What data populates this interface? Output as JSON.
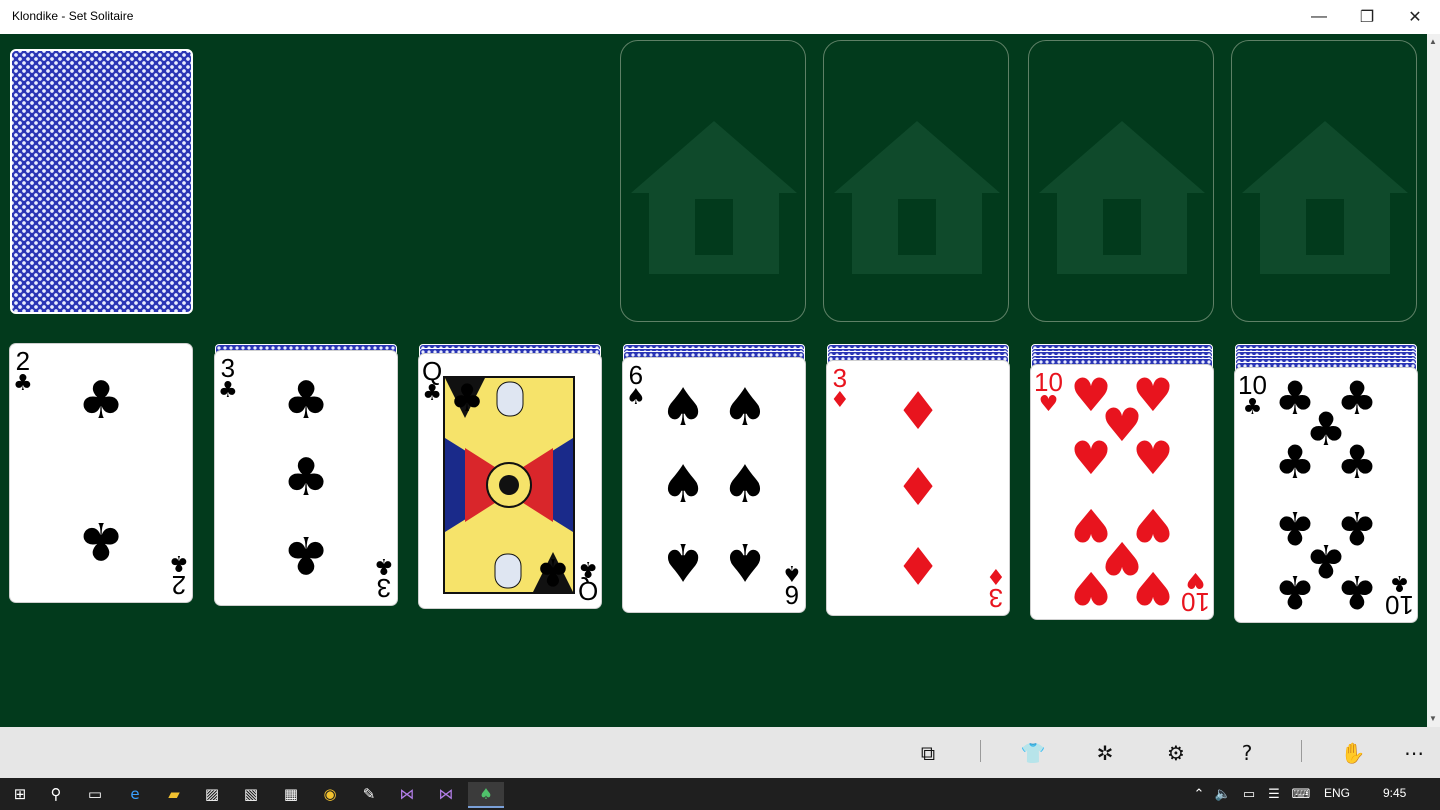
{
  "window": {
    "title": "Klondike - Set Solitaire",
    "controls": {
      "minimize": "—",
      "restore": "❐",
      "close": "✕"
    }
  },
  "colors": {
    "felt": "#023a1c",
    "red_suit": "#e8141e",
    "black_suit": "#000000",
    "card_back": "#2a35b5"
  },
  "stock": {
    "face": "down",
    "icon": "card-back-pattern"
  },
  "foundations": [
    {
      "icon": "house-icon"
    },
    {
      "icon": "house-icon"
    },
    {
      "icon": "house-icon"
    },
    {
      "icon": "house-icon"
    }
  ],
  "tableau": [
    {
      "hidden_cards": 0,
      "top": {
        "rank": "2",
        "suit": "♣",
        "color": "black"
      }
    },
    {
      "hidden_cards": 1,
      "top": {
        "rank": "3",
        "suit": "♣",
        "color": "black"
      }
    },
    {
      "hidden_cards": 2,
      "top": {
        "rank": "Q",
        "suit": "♣",
        "color": "black"
      }
    },
    {
      "hidden_cards": 3,
      "top": {
        "rank": "6",
        "suit": "♠",
        "color": "black"
      }
    },
    {
      "hidden_cards": 4,
      "top": {
        "rank": "3",
        "suit": "♦",
        "color": "red"
      }
    },
    {
      "hidden_cards": 5,
      "top": {
        "rank": "10",
        "suit": "♥",
        "color": "red"
      }
    },
    {
      "hidden_cards": 6,
      "top": {
        "rank": "10",
        "suit": "♣",
        "color": "black"
      }
    }
  ],
  "command_bar": {
    "items": [
      {
        "icon": "hint-icon",
        "glyph": "⧉"
      },
      {
        "icon": "card-back-theme-icon",
        "glyph": "👕"
      },
      {
        "icon": "auto-finish-icon",
        "glyph": "✲"
      },
      {
        "icon": "settings-icon",
        "glyph": "⚙"
      },
      {
        "icon": "help-icon",
        "glyph": "?"
      },
      {
        "icon": "deal-hand-icon",
        "glyph": "✋"
      },
      {
        "icon": "more-icon",
        "glyph": "⋯"
      }
    ]
  },
  "taskbar": {
    "items": [
      {
        "icon": "windows-start-icon",
        "glyph": "⊞"
      },
      {
        "icon": "search-icon",
        "glyph": "⚲"
      },
      {
        "icon": "task-view-icon",
        "glyph": "▭"
      },
      {
        "icon": "edge-icon",
        "glyph": "e"
      },
      {
        "icon": "file-explorer-icon",
        "glyph": "▰"
      },
      {
        "icon": "remote-desktop-icon",
        "glyph": "▨"
      },
      {
        "icon": "remote-app-icon",
        "glyph": "▧"
      },
      {
        "icon": "calculator-icon",
        "glyph": "▦"
      },
      {
        "icon": "chrome-icon",
        "glyph": "◉"
      },
      {
        "icon": "paint-icon",
        "glyph": "✎"
      },
      {
        "icon": "visual-studio-icon",
        "glyph": "⋈"
      },
      {
        "icon": "visual-studio-2-icon",
        "glyph": "⋈"
      },
      {
        "icon": "solitaire-app-icon",
        "glyph": "♠"
      }
    ],
    "tray": {
      "language": "ENG",
      "time": "9:45"
    },
    "tray_icons": [
      {
        "icon": "show-hidden-icons",
        "glyph": "⌃"
      },
      {
        "icon": "volume-icon",
        "glyph": "🔈"
      },
      {
        "icon": "network-icon",
        "glyph": "▭"
      },
      {
        "icon": "action-center-icon",
        "glyph": "☰"
      },
      {
        "icon": "keyboard-icon",
        "glyph": "⌨"
      }
    ]
  }
}
